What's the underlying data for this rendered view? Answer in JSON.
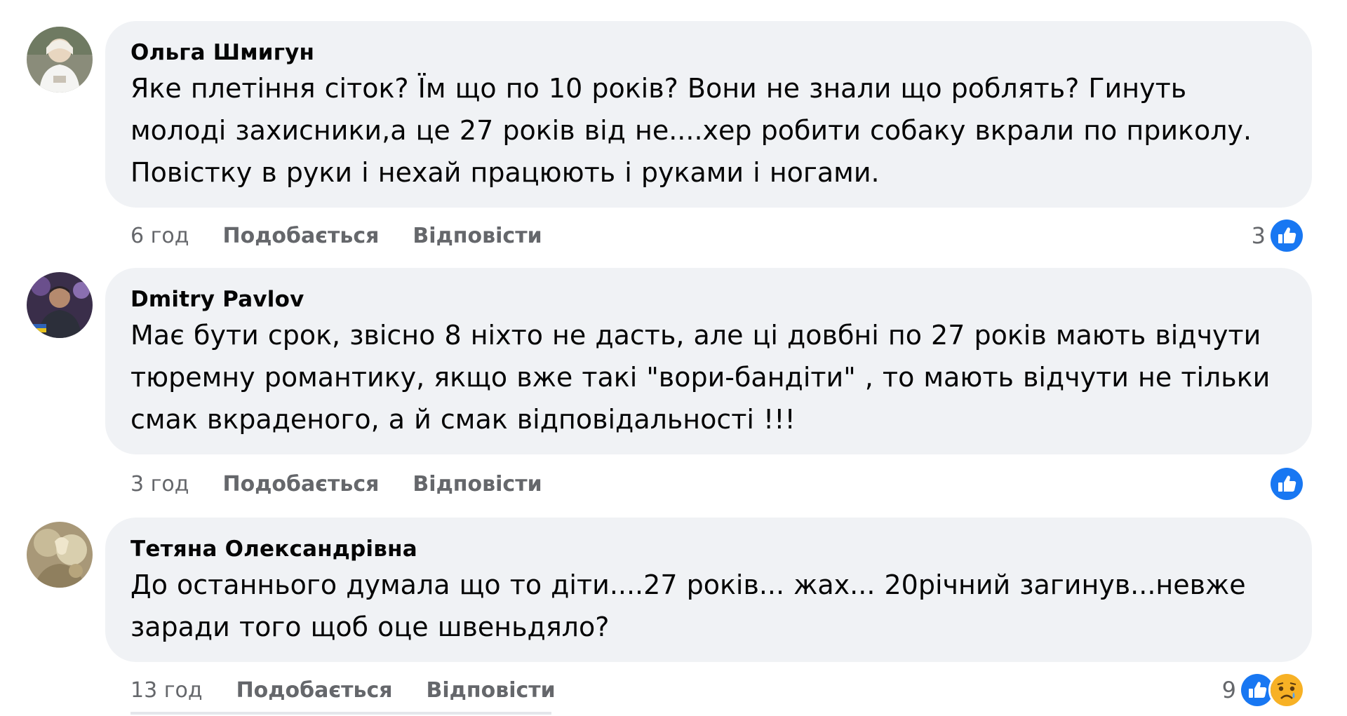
{
  "comments": [
    {
      "author": "Ольга Шмигун",
      "lines": [
        "Яке плетіння сіток? Їм що по 10 років? Вони не знали що роблять? Гинуть",
        "молоді захисники,а це 27 років від не....хер робити собаку вкрали по приколу.",
        "Повістку в руки і нехай працюють і руками і ногами."
      ],
      "time": "6 год",
      "like_label": "Подобається",
      "reply_label": "Відповісти",
      "reaction_count": "3",
      "reactions": [
        "like-icon"
      ]
    },
    {
      "author": "Dmitry Pavlov",
      "lines": [
        "Має бути срок, звісно 8 ніхто не дасть, але ці довбні по 27 років мають відчути",
        "тюремну романтику, якщо вже такі \"вори-бандіти\" , то мають відчути не тільки",
        "смак вкраденого, а й смак відповідальності !!!"
      ],
      "time": "3 год",
      "like_label": "Подобається",
      "reply_label": "Відповісти",
      "reaction_count": "",
      "reactions": [
        "like-icon"
      ]
    },
    {
      "author": "Тетяна Олександрівна",
      "lines": [
        "До останнього думала що то діти....27 років... жах... 20річний загинув...невже",
        "заради того щоб оце швеньдяло?"
      ],
      "time": "13 год",
      "like_label": "Подобається",
      "reply_label": "Відповісти",
      "reaction_count": "9",
      "reactions": [
        "like-icon",
        "sad-icon"
      ]
    }
  ],
  "colors": {
    "bubble": "#f0f2f5",
    "text": "#050505",
    "meta": "#65676b",
    "like_blue": "#1877f2",
    "sad_yellow": "#f7b125"
  }
}
